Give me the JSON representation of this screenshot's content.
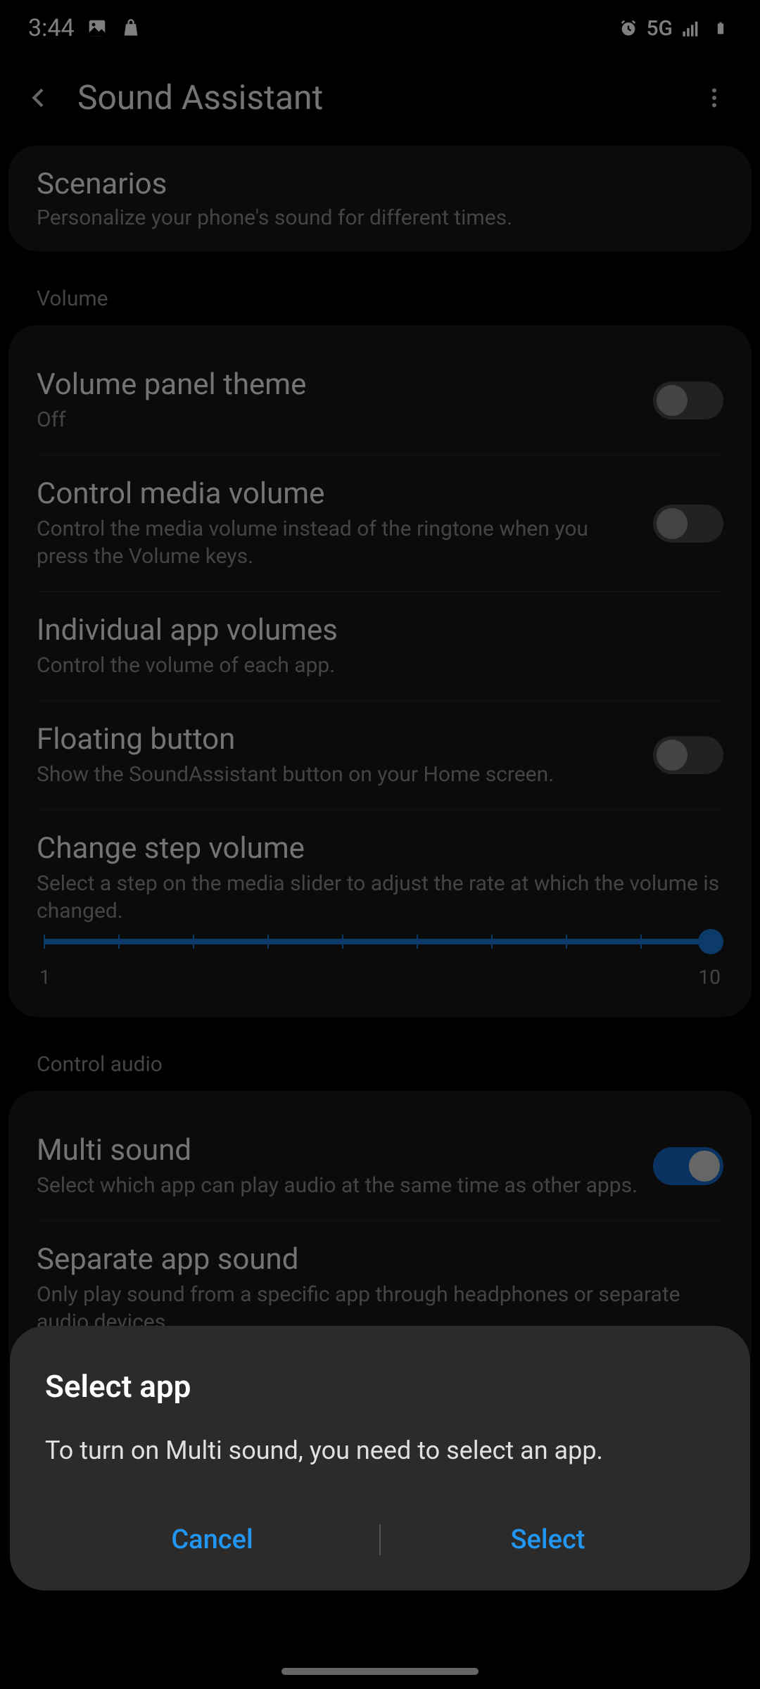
{
  "status": {
    "time": "3:44",
    "network": "5G"
  },
  "header": {
    "title": "Sound Assistant"
  },
  "scenarios": {
    "title": "Scenarios",
    "sub": "Personalize your phone's sound for different times."
  },
  "sections": {
    "volume": "Volume",
    "control_audio": "Control audio"
  },
  "settings": {
    "volume_panel": {
      "title": "Volume panel theme",
      "sub": "Off"
    },
    "control_media": {
      "title": "Control media volume",
      "sub": "Control the media volume instead of the ringtone when you press the Volume keys."
    },
    "individual": {
      "title": "Individual app volumes",
      "sub": "Control the volume of each app."
    },
    "floating": {
      "title": "Floating button",
      "sub": "Show the SoundAssistant button on your Home screen."
    },
    "step": {
      "title": "Change step volume",
      "sub": "Select a step on the media slider to adjust the rate at which the volume is changed.",
      "min": "1",
      "max": "10"
    },
    "multi_sound": {
      "title": "Multi sound",
      "sub": "Select which app can play audio at the same time as other apps."
    },
    "separate": {
      "title": "Separate app sound",
      "sub": "Only play sound from a specific app through headphones or separate audio devices."
    }
  },
  "dialog": {
    "title": "Select app",
    "message": "To turn on Multi sound, you need to select an app.",
    "cancel": "Cancel",
    "select": "Select"
  }
}
